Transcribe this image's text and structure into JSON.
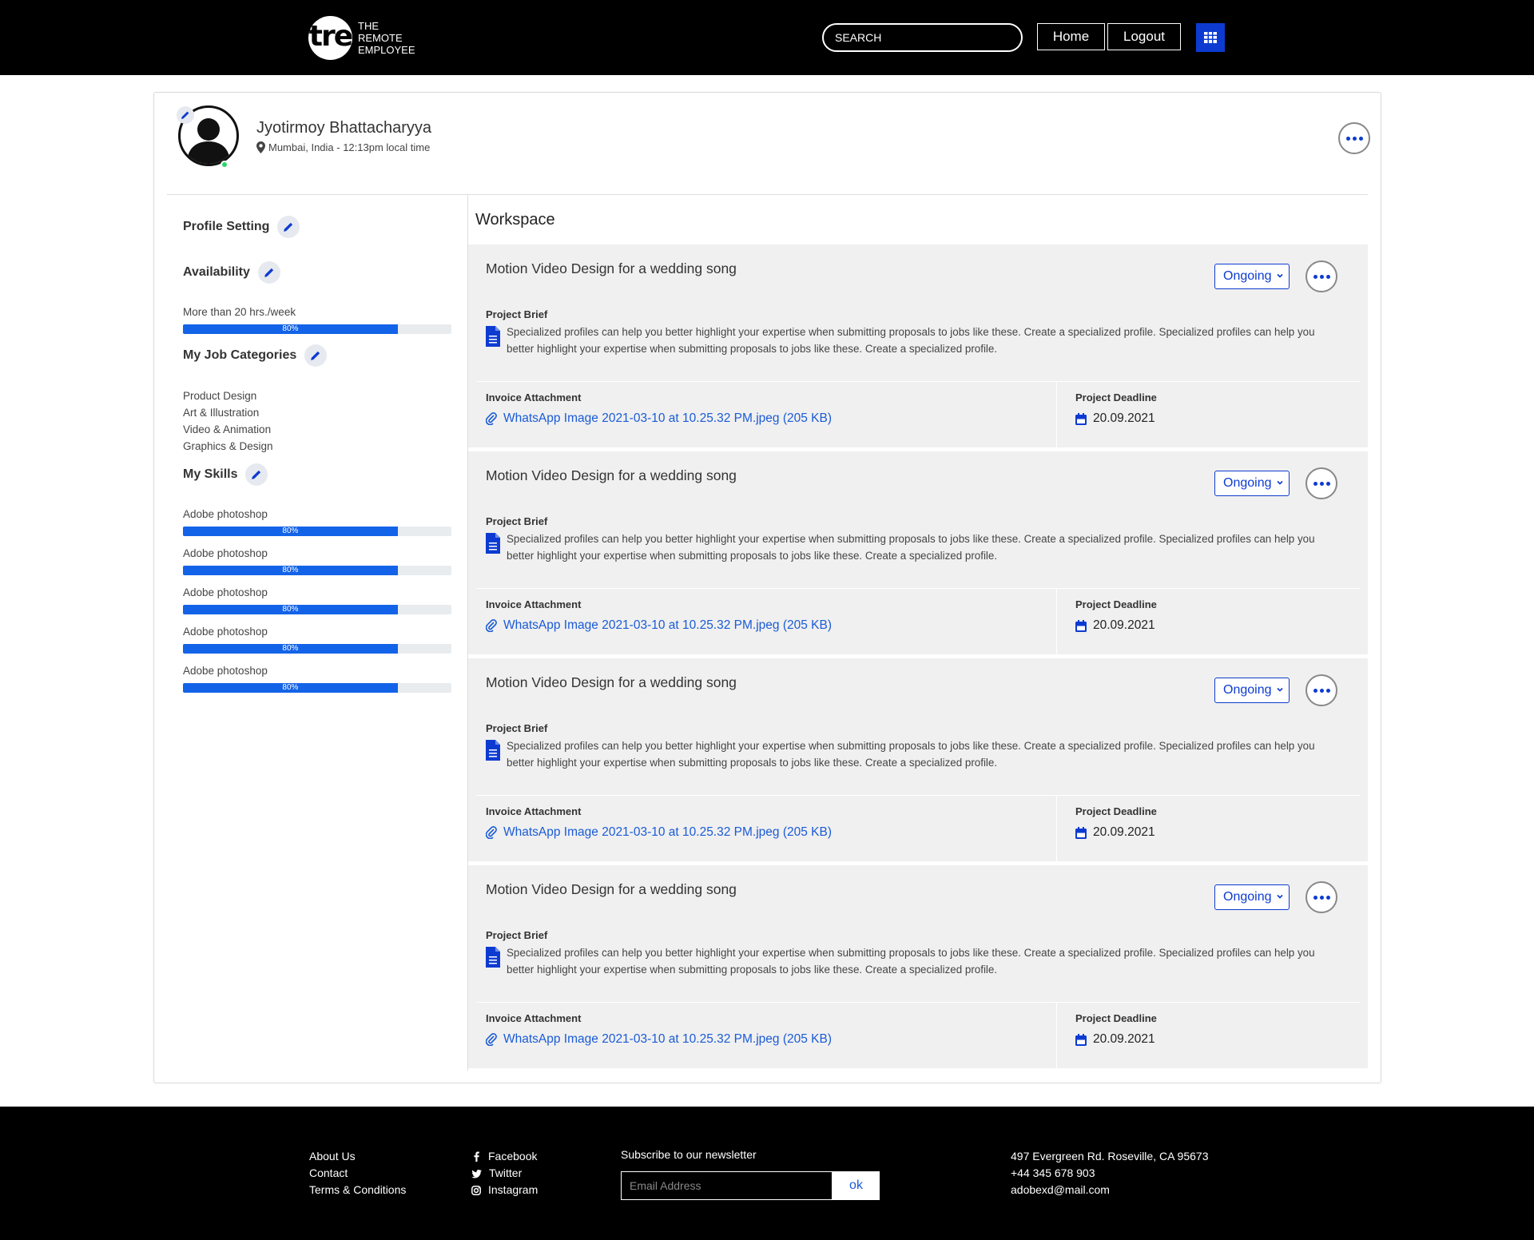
{
  "brand": {
    "logo_mark": "tre",
    "logo_line1": "THE",
    "logo_line2": "REMOTE",
    "logo_line3": "EMPLOYEE"
  },
  "header": {
    "search_placeholder": "SEARCH",
    "home_label": "Home",
    "logout_label": "Logout",
    "grid_icon": "grid-icon"
  },
  "profile": {
    "name": "Jyotirmoy Bhattacharyya",
    "location": "Mumbai, India - 12:13pm local time",
    "online": true
  },
  "sidebar": {
    "profile_setting_title": "Profile Setting",
    "availability_title": "Availability",
    "availability_text": "More than 20 hrs./week",
    "availability_label": "80%",
    "availability_value": 0.8,
    "job_categories_title": "My Job Categories",
    "job_categories": [
      "Product Design",
      "Art & Illustration",
      "Video & Animation",
      "Graphics & Design"
    ],
    "skills_title": "My Skills",
    "skills": [
      {
        "name": "Adobe photoshop",
        "label": "80%",
        "value": 0.8
      },
      {
        "name": "Adobe photoshop",
        "label": "80%",
        "value": 0.8
      },
      {
        "name": "Adobe photoshop",
        "label": "80%",
        "value": 0.8
      },
      {
        "name": "Adobe photoshop",
        "label": "80%",
        "value": 0.8
      },
      {
        "name": "Adobe photoshop",
        "label": "80%",
        "value": 0.8
      }
    ]
  },
  "workspace": {
    "title": "Workspace",
    "projects": [
      {
        "title": "Motion Video Design for a wedding song",
        "status": "Ongoing",
        "brief_label": "Project Brief",
        "brief": "Specialized profiles can help you better highlight your expertise when submitting proposals to jobs like these. Create a specialized profile. Specialized profiles can help you better highlight your expertise when submitting proposals to jobs like these. Create a specialized profile.",
        "invoice_label": "Invoice Attachment",
        "invoice_file": "WhatsApp Image 2021-03-10 at 10.25.32 PM.jpeg (205 KB)",
        "deadline_label": "Project Deadline",
        "deadline": "20.09.2021"
      },
      {
        "title": "Motion Video Design for a wedding song",
        "status": "Ongoing",
        "brief_label": "Project Brief",
        "brief": "Specialized profiles can help you better highlight your expertise when submitting proposals to jobs like these. Create a specialized profile. Specialized profiles can help you better highlight your expertise when submitting proposals to jobs like these. Create a specialized profile.",
        "invoice_label": "Invoice Attachment",
        "invoice_file": "WhatsApp Image 2021-03-10 at 10.25.32 PM.jpeg (205 KB)",
        "deadline_label": "Project Deadline",
        "deadline": "20.09.2021"
      },
      {
        "title": "Motion Video Design for a wedding song",
        "status": "Ongoing",
        "brief_label": "Project Brief",
        "brief": "Specialized profiles can help you better highlight your expertise when submitting proposals to jobs like these. Create a specialized profile. Specialized profiles can help you better highlight your expertise when submitting proposals to jobs like these. Create a specialized profile.",
        "invoice_label": "Invoice Attachment",
        "invoice_file": "WhatsApp Image 2021-03-10 at 10.25.32 PM.jpeg (205 KB)",
        "deadline_label": "Project Deadline",
        "deadline": "20.09.2021"
      },
      {
        "title": "Motion Video Design for a wedding song",
        "status": "Ongoing",
        "brief_label": "Project Brief",
        "brief": "Specialized profiles can help you better highlight your expertise when submitting proposals to jobs like these. Create a specialized profile. Specialized profiles can help you better highlight your expertise when submitting proposals to jobs like these. Create a specialized profile.",
        "invoice_label": "Invoice Attachment",
        "invoice_file": "WhatsApp Image 2021-03-10 at 10.25.32 PM.jpeg (205 KB)",
        "deadline_label": "Project Deadline",
        "deadline": "20.09.2021"
      }
    ]
  },
  "footer": {
    "links": [
      "About Us",
      "Contact",
      "Terms & Conditions"
    ],
    "social": [
      {
        "label": "Facebook",
        "icon": "facebook-icon"
      },
      {
        "label": "Twitter",
        "icon": "twitter-icon"
      },
      {
        "label": "Instagram",
        "icon": "instagram-icon"
      }
    ],
    "newsletter_label": "Subscribe to our newsletter",
    "newsletter_placeholder": "Email Address",
    "newsletter_button": "ok",
    "address": "497 Evergreen Rd. Roseville, CA 95673",
    "phone": "+44 345 678 903",
    "email": "adobexd@mail.com"
  },
  "colors": {
    "accent": "#0d3bd1",
    "progress": "#1363e8",
    "link": "#1a5bd6",
    "online": "#2bd46a"
  }
}
